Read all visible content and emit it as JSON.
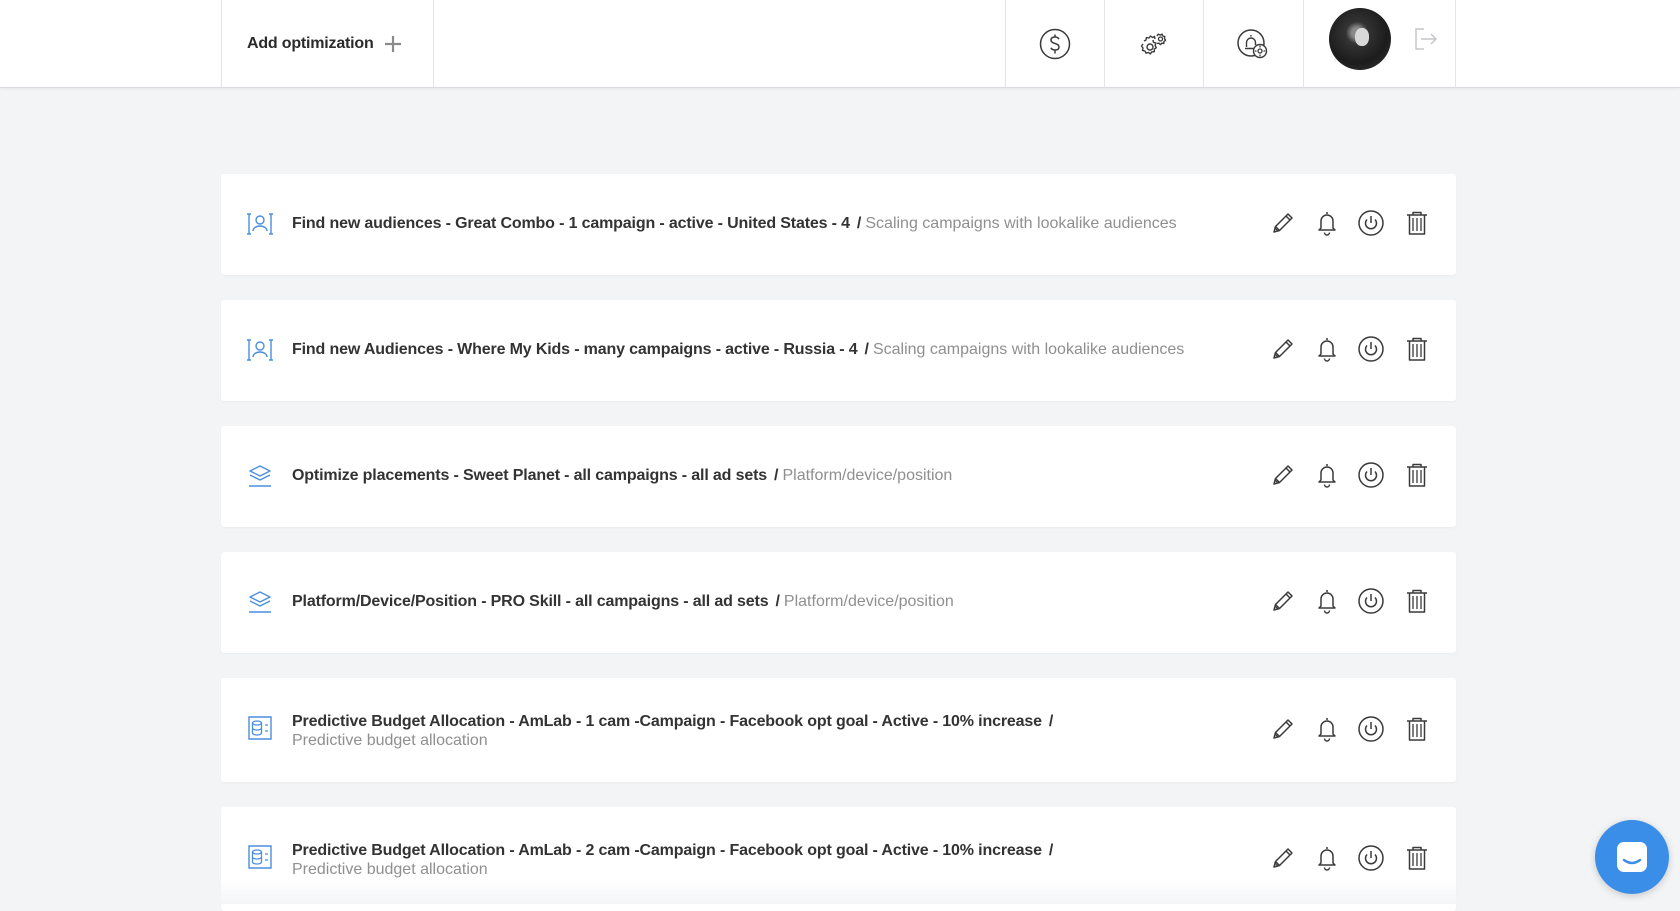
{
  "header": {
    "add_label": "Add optimization",
    "icons": [
      "dollar-icon",
      "settings-gears-icon",
      "notification-settings-icon",
      "avatar",
      "logout-icon"
    ]
  },
  "optimizations": [
    {
      "icon": "audience-icon",
      "title": "Find new audiences - Great Combo - 1 campaign - active - United States - 4",
      "separator": "/",
      "subtitle": "Scaling campaigns with lookalike audiences"
    },
    {
      "icon": "audience-icon",
      "title": "Find new Audiences - Where My Kids - many campaigns - active - Russia - 4",
      "separator": "/",
      "subtitle": "Scaling campaigns with lookalike audiences"
    },
    {
      "icon": "layers-icon",
      "title": "Optimize placements - Sweet Planet - all campaigns - all ad sets",
      "separator": "/",
      "subtitle": "Platform/device/position"
    },
    {
      "icon": "layers-icon",
      "title": "Platform/Device/Position - PRO Skill - all campaigns - all ad sets",
      "separator": "/",
      "subtitle": "Platform/device/position"
    },
    {
      "icon": "budget-icon",
      "title": "Predictive Budget Allocation - AmLab - 1 cam -Campaign - Facebook opt goal - Active - 10% increase",
      "separator": "/",
      "subtitle": "Predictive budget allocation"
    },
    {
      "icon": "budget-icon",
      "title": "Predictive Budget Allocation - AmLab - 2 cam -Campaign - Facebook opt goal - Active - 10% increase",
      "separator": "/",
      "subtitle": "Predictive budget allocation"
    }
  ],
  "colors": {
    "accent": "#4a8fe0",
    "icon_dark": "#3a3a3a",
    "background": "#f3f4f6",
    "chat": "#3a8ee8"
  }
}
